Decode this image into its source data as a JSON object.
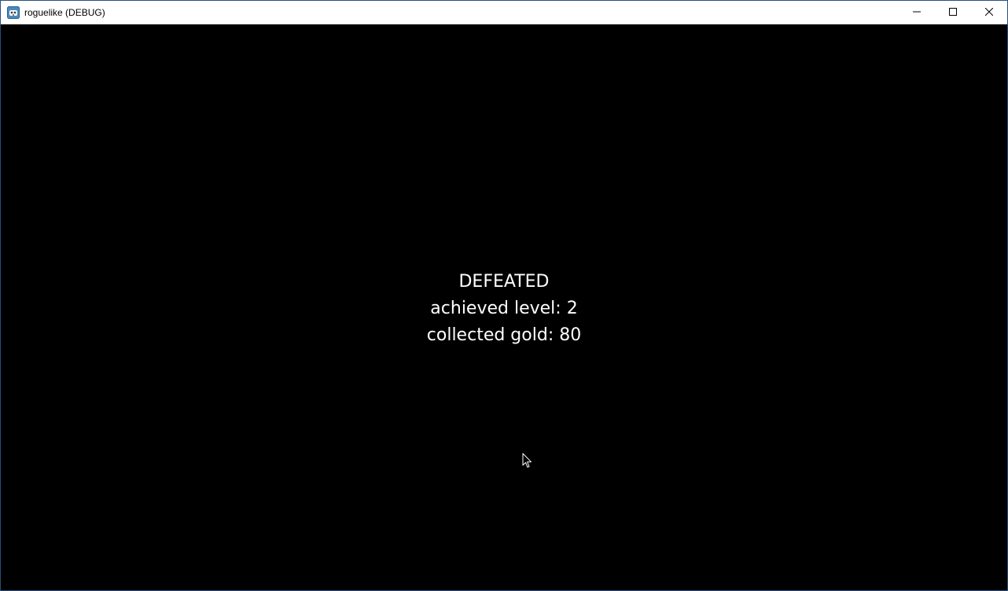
{
  "window": {
    "title": "roguelike (DEBUG)",
    "app_icon": "godot-engine-icon",
    "controls": {
      "minimize_icon": "minimize-icon",
      "maximize_icon": "maximize-icon",
      "close_icon": "close-icon"
    }
  },
  "game": {
    "background_color": "#000000",
    "text_color": "#ffffff",
    "status": "DEFEATED",
    "level_line": "achieved level: 2",
    "gold_line": "collected gold: 80"
  },
  "cursor_icon": "mouse-pointer-icon"
}
